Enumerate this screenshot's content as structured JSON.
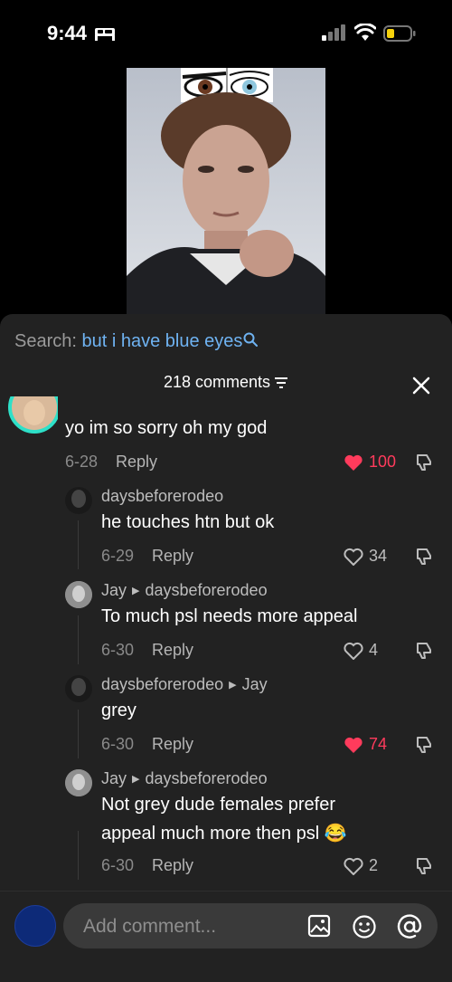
{
  "status": {
    "time": "9:44"
  },
  "search": {
    "label": "Search:",
    "term": "but i have blue eyes"
  },
  "comments_header": {
    "count": "218 comments"
  },
  "top_comment": {
    "text": "yo im so sorry oh my god",
    "date": "6-28",
    "reply": "Reply",
    "likes": "100",
    "liked": true
  },
  "replies": [
    {
      "user": "daysbeforerodeo",
      "to": "",
      "text": "he touches htn but ok",
      "date": "6-29",
      "reply": "Reply",
      "likes": "34",
      "liked": false
    },
    {
      "user": "Jay",
      "to": "daysbeforerodeo",
      "text": "To much psl needs more appeal",
      "date": "6-30",
      "reply": "Reply",
      "likes": "4",
      "liked": false
    },
    {
      "user": "daysbeforerodeo",
      "to": "Jay",
      "text": "grey",
      "date": "6-30",
      "reply": "Reply",
      "likes": "74",
      "liked": true
    },
    {
      "user": "Jay",
      "to": "daysbeforerodeo",
      "text_line1": "Not grey dude females prefer",
      "text_line2": "appeal much more then psl",
      "emoji": "😂",
      "date": "6-30",
      "reply": "Reply",
      "likes": "2",
      "liked": false
    }
  ],
  "composer": {
    "placeholder": "Add comment..."
  },
  "icons": [
    "bed-icon",
    "signal-icon",
    "wifi-icon",
    "battery-icon",
    "search-icon",
    "filter-icon",
    "close-icon",
    "heart-icon",
    "dislike-icon",
    "image-icon",
    "emoji-icon",
    "mention-icon"
  ],
  "colors": {
    "accent_blue": "#6fb3f2",
    "like_red": "#ff3b5c",
    "battery_yellow": "#f5d10b",
    "sheet": "#222222"
  }
}
